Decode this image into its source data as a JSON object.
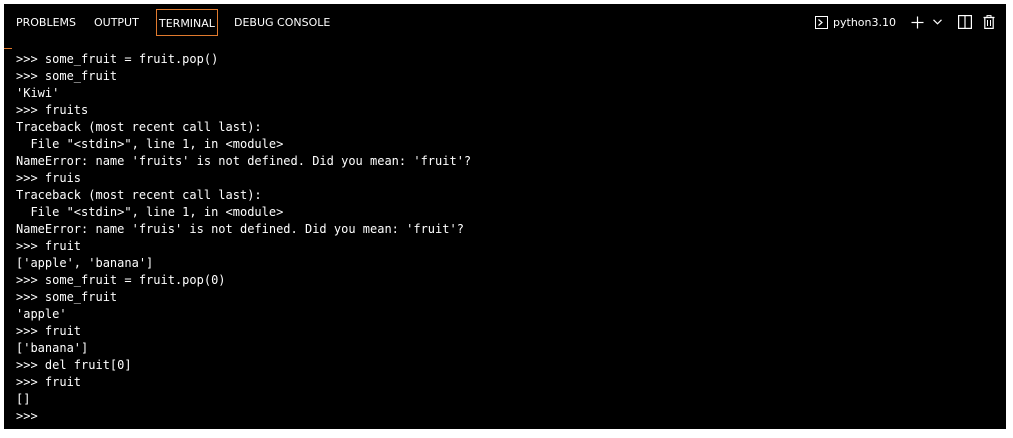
{
  "tabs": [
    {
      "label": "PROBLEMS"
    },
    {
      "label": "OUTPUT"
    },
    {
      "label": "TERMINAL",
      "active": true
    },
    {
      "label": "DEBUG CONSOLE"
    }
  ],
  "terminal_selector": {
    "label": "python3.10",
    "icon": "terminal-prompt-icon"
  },
  "actions": {
    "new_terminal_icon": "plus-icon",
    "dropdown_icon": "chevron-down-icon",
    "split_icon": "split-terminal-icon",
    "kill_icon": "trash-icon"
  },
  "colors": {
    "background": "#000000",
    "text": "#ffffff",
    "accent": "#e07a2e"
  },
  "terminal": {
    "lines": [
      ">>> some_fruit = fruit.pop()",
      ">>> some_fruit",
      "'Kiwi'",
      ">>> fruits",
      "Traceback (most recent call last):",
      "  File \"<stdin>\", line 1, in <module>",
      "NameError: name 'fruits' is not defined. Did you mean: 'fruit'?",
      ">>> fruis",
      "Traceback (most recent call last):",
      "  File \"<stdin>\", line 1, in <module>",
      "NameError: name 'fruis' is not defined. Did you mean: 'fruit'?",
      ">>> fruit",
      "['apple', 'banana']",
      ">>> some_fruit = fruit.pop(0)",
      ">>> some_fruit",
      "'apple'",
      ">>> fruit",
      "['banana']",
      ">>> del fruit[0]",
      ">>> fruit",
      "[]",
      ">>>"
    ]
  }
}
